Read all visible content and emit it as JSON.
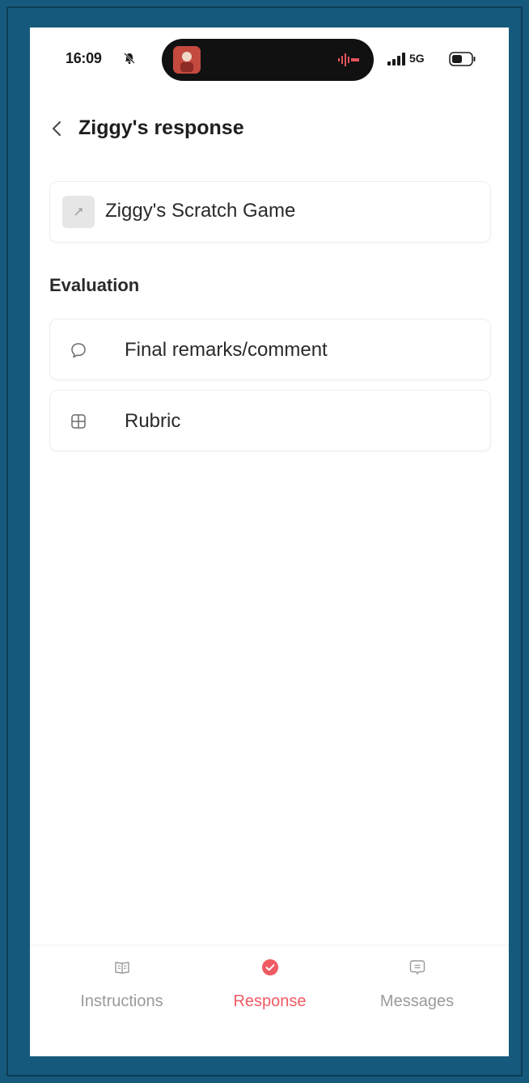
{
  "status_bar": {
    "time": "16:09",
    "network": "5G"
  },
  "header": {
    "title": "Ziggy's response"
  },
  "attachment": {
    "label": "Ziggy's Scratch Game"
  },
  "evaluation": {
    "heading": "Evaluation",
    "items": [
      {
        "label": "Final remarks/comment",
        "icon": "speech-bubble-icon"
      },
      {
        "label": "Rubric",
        "icon": "grid-icon"
      }
    ]
  },
  "tabs": [
    {
      "label": "Instructions",
      "icon": "book-icon",
      "active": false
    },
    {
      "label": "Response",
      "icon": "check-circle-icon",
      "active": true
    },
    {
      "label": "Messages",
      "icon": "message-icon",
      "active": false
    }
  ],
  "colors": {
    "accent": "#ef5a63",
    "frame": "#155a7c",
    "text": "#2a2a2a",
    "muted": "#9a9a9a"
  }
}
